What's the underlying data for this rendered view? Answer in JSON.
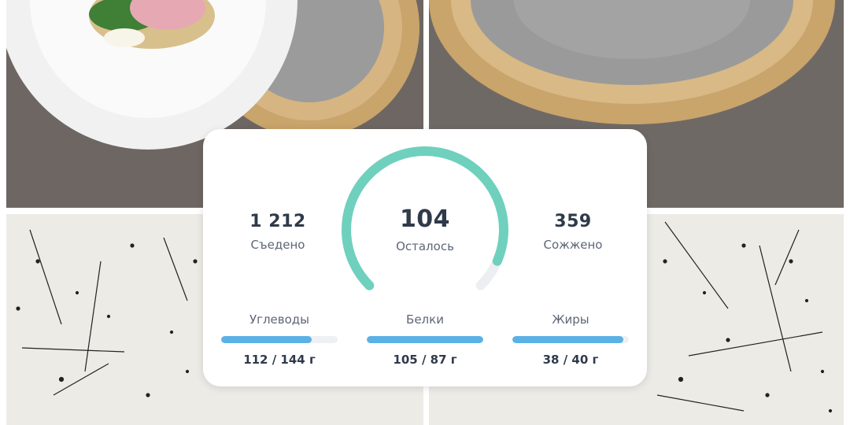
{
  "colors": {
    "gauge_fill": "#6fd0bd",
    "gauge_track": "#eceef1",
    "bar_fill": "#5bb1e5",
    "bar_track": "#eef0f3",
    "card_bg": "#ffffff"
  },
  "summary": {
    "eaten": {
      "value": "1 212",
      "label": "Съедено"
    },
    "remaining": {
      "value": "104",
      "label": "Осталось",
      "progress": 0.92
    },
    "burned": {
      "value": "359",
      "label": "Сожжено"
    }
  },
  "macros": [
    {
      "label": "Углеводы",
      "value": "112 / 144 г",
      "progress": 0.78
    },
    {
      "label": "Белки",
      "value": "105 / 87 г",
      "progress": 1.0
    },
    {
      "label": "Жиры",
      "value": "38 / 40 г",
      "progress": 0.95
    }
  ],
  "background_photos": [
    "plate-with-sandwich",
    "woven-placemat",
    "speckled-surface",
    "speckled-surface"
  ]
}
